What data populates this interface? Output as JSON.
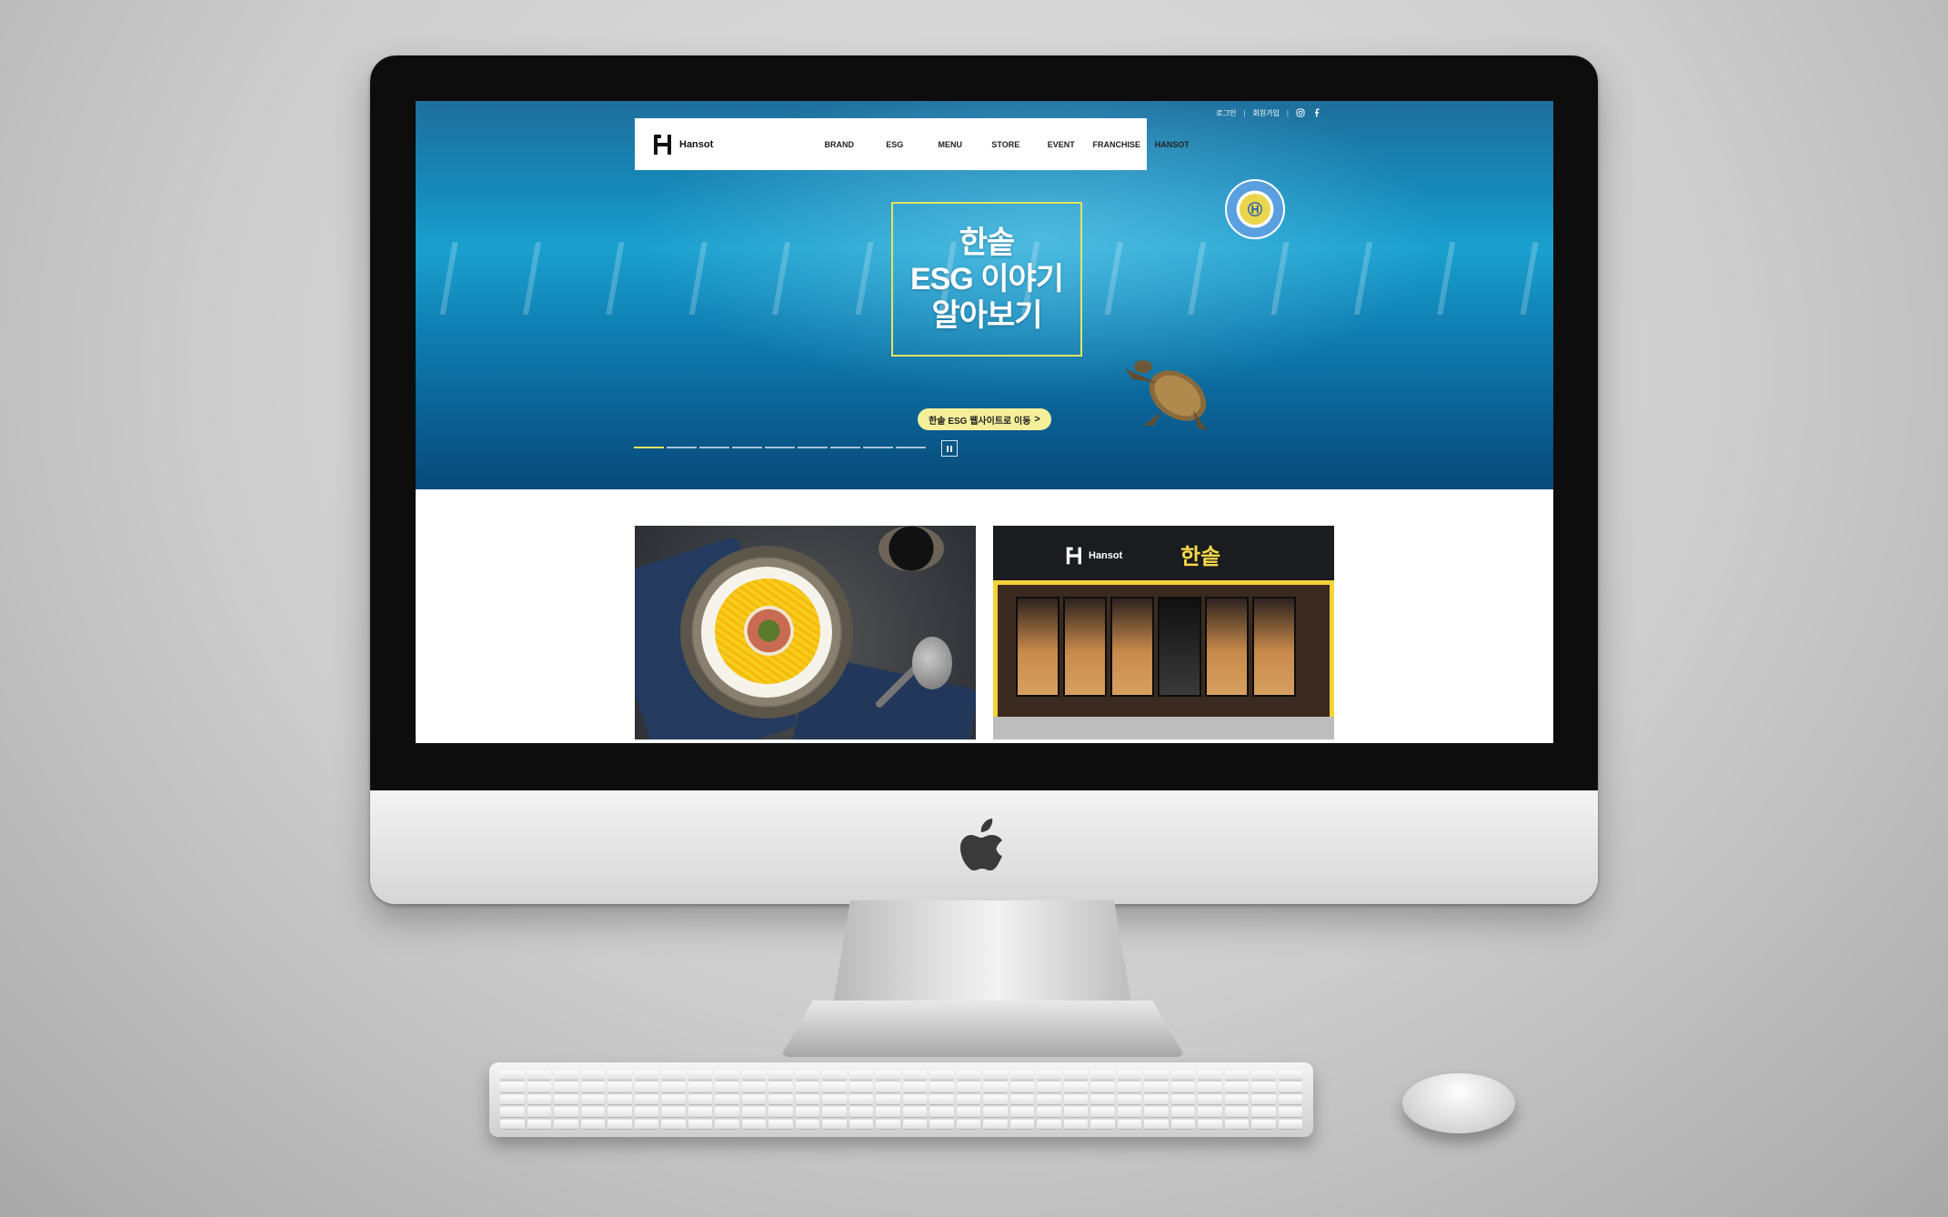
{
  "topbar": {
    "login": "로그인",
    "signup": "회원가입",
    "instagram_icon": "instagram-icon",
    "facebook_icon": "facebook-icon"
  },
  "nav": {
    "brand_text": "Hansot",
    "items": [
      "BRAND",
      "ESG",
      "MENU",
      "STORE",
      "EVENT",
      "FRANCHISE",
      "HANSOT"
    ]
  },
  "hero": {
    "title_lines": [
      "한솥",
      "ESG 이야기",
      "알아보기"
    ],
    "cta_label": "한솥 ESG 웹사이트로 이동",
    "cta_arrow": ">",
    "slide_count": 9,
    "active_slide": 1,
    "accent_color": "#e4e35f"
  },
  "cards": {
    "store_logo_text": "Hansot",
    "store_sign_korean": "한솥"
  }
}
